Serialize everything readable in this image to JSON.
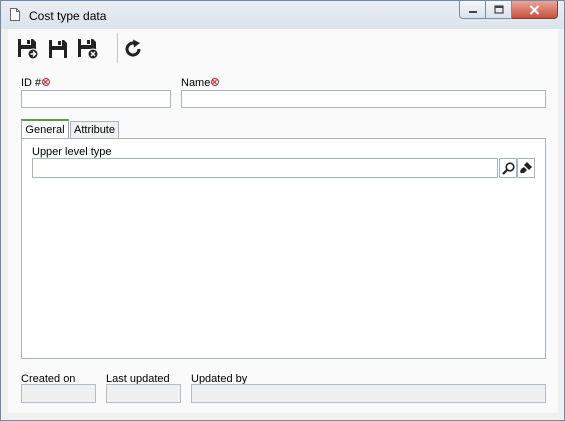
{
  "window": {
    "title": "Cost type data",
    "icons": [
      "document-icon",
      "minimize-icon",
      "maximize-icon",
      "close-icon"
    ]
  },
  "toolbar": {
    "buttons": [
      {
        "name": "save-and-new-button",
        "icon": "save-new-icon"
      },
      {
        "name": "save-button",
        "icon": "save-icon"
      },
      {
        "name": "save-and-close-button",
        "icon": "save-close-icon"
      },
      {
        "name": "refresh-button",
        "icon": "refresh-icon"
      }
    ]
  },
  "form": {
    "id_label": "ID #",
    "id_value": "",
    "name_label": "Name",
    "name_value": ""
  },
  "tabs": [
    {
      "label": "General",
      "active": true
    },
    {
      "label": "Attribute",
      "active": false
    }
  ],
  "general": {
    "upper_level_label": "Upper level type",
    "upper_level_value": "",
    "icons": [
      "search-icon",
      "clear-icon"
    ]
  },
  "footer": {
    "created_on_label": "Created on",
    "created_on_value": "",
    "last_updated_label": "Last updated",
    "last_updated_value": "",
    "updated_by_label": "Updated by",
    "updated_by_value": ""
  },
  "colors": {
    "required": "#c0282d",
    "active_tab_accent": "#5c9a48",
    "close_button": "#c7503c"
  }
}
